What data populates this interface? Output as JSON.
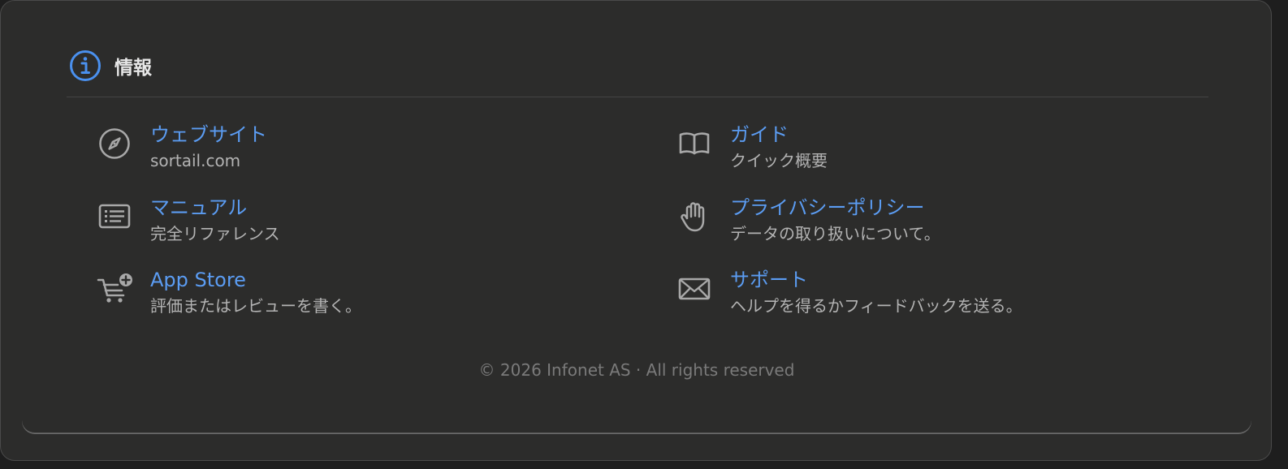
{
  "section": {
    "title": "情報",
    "icon": "info-circle-icon"
  },
  "links": [
    {
      "icon": "compass-icon",
      "label": "ウェブサイト",
      "sub": "sortail.com"
    },
    {
      "icon": "book-icon",
      "label": "ガイド",
      "sub": "クイック概要"
    },
    {
      "icon": "manual-document-icon",
      "label": "マニュアル",
      "sub": "完全リファレンス"
    },
    {
      "icon": "hand-raised-icon",
      "label": "プライバシーポリシー",
      "sub": "データの取り扱いについて。"
    },
    {
      "icon": "cart-plus-icon",
      "label": "App Store",
      "sub": "評価またはレビューを書く。"
    },
    {
      "icon": "envelope-icon",
      "label": "サポート",
      "sub": "ヘルプを得るかフィードバックを送る。"
    }
  ],
  "footer": {
    "text": "© 2026 Infonet AS · All rights reserved"
  },
  "colors": {
    "accent": "#5b9cf2",
    "background": "#2c2c2b",
    "icon_gray": "#a8a8a8"
  }
}
